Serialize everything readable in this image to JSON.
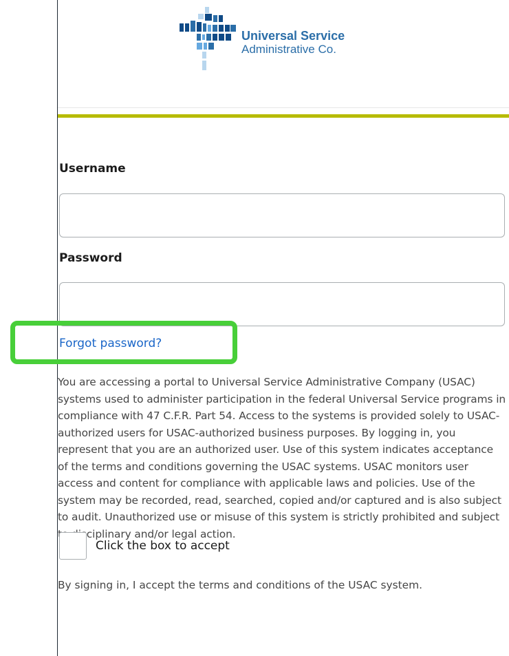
{
  "brand": {
    "name_line1": "Universal Service",
    "name_line2": "Administrative Co.",
    "logo_icon": "usac-logo-icon",
    "logo_colors": [
      "#2b6ea8",
      "#66a9e0",
      "#b8d6ee",
      "#0f4a86"
    ],
    "accent_color": "#b7bb00"
  },
  "login_form": {
    "username_label": "Username",
    "username_value": "",
    "password_label": "Password",
    "password_value": "",
    "forgot_password_link": "Forgot password?"
  },
  "legal_notice": "You are accessing a portal to Universal Service Administrative Company (USAC) systems used to administer participation in the federal Universal Service programs in compliance with 47 C.F.R. Part 54. Access to the systems is provided solely to USAC-authorized users for USAC-authorized business purposes. By logging in, you represent that you are an authorized user. Use of this system indicates acceptance of the terms and conditions governing the USAC systems. USAC monitors user access and content for compliance with applicable laws and policies. Use of the system may be recorded, read, searched, copied and/or captured and is also subject to audit. Unauthorized use or misuse of this system is strictly prohibited and subject to disciplinary and/or legal action.",
  "accept": {
    "checkbox_label": "Click the box to accept",
    "checked": false,
    "footer_note": "By signing in, I accept the terms and conditions of the USAC system."
  },
  "annotation": {
    "highlight_color": "#48cf39"
  }
}
